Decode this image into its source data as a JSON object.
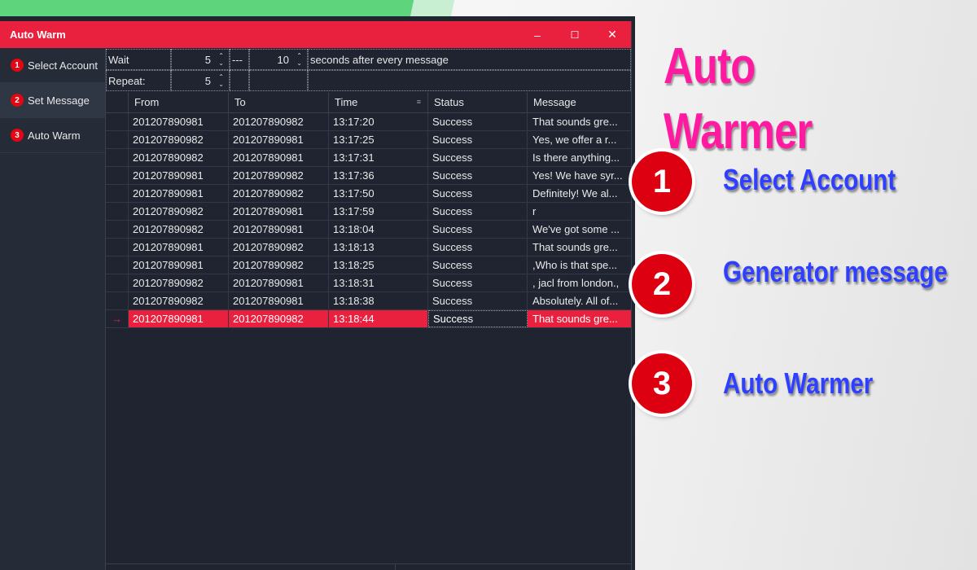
{
  "window": {
    "title": "Auto Warm",
    "controls": {
      "minimize": "–",
      "maximize": "☐",
      "close": "✕"
    }
  },
  "sidebar": {
    "items": [
      {
        "num": "1",
        "label": "Select Account"
      },
      {
        "num": "2",
        "label": "Set Message"
      },
      {
        "num": "3",
        "label": "Auto Warm"
      }
    ]
  },
  "settings": {
    "wait_label": "Wait",
    "wait_min": "5",
    "separator": "---",
    "wait_max": "10",
    "wait_suffix": "seconds after every message",
    "repeat_label": "Repeat:",
    "repeat_value": "5"
  },
  "grid": {
    "columns": [
      "From",
      "To",
      "Time",
      "Status",
      "Message"
    ],
    "selected_marker": "→",
    "rows": [
      {
        "from": "201207890981",
        "to": "201207890982",
        "time": "13:17:20",
        "status": "Success",
        "message": "That sounds gre..."
      },
      {
        "from": "201207890982",
        "to": "201207890981",
        "time": "13:17:25",
        "status": "Success",
        "message": "Yes, we offer a r..."
      },
      {
        "from": "201207890982",
        "to": "201207890981",
        "time": "13:17:31",
        "status": "Success",
        "message": "Is there anything..."
      },
      {
        "from": "201207890981",
        "to": "201207890982",
        "time": "13:17:36",
        "status": "Success",
        "message": "Yes! We have syr..."
      },
      {
        "from": "201207890981",
        "to": "201207890982",
        "time": "13:17:50",
        "status": "Success",
        "message": "Definitely! We al..."
      },
      {
        "from": "201207890982",
        "to": "201207890981",
        "time": "13:17:59",
        "status": "Success",
        "message": "r"
      },
      {
        "from": "201207890982",
        "to": "201207890981",
        "time": "13:18:04",
        "status": "Success",
        "message": "We've got some ..."
      },
      {
        "from": "201207890981",
        "to": "201207890982",
        "time": "13:18:13",
        "status": "Success",
        "message": "That sounds gre..."
      },
      {
        "from": "201207890981",
        "to": "201207890982",
        "time": "13:18:25",
        "status": "Success",
        "message": ",Who is that spe..."
      },
      {
        "from": "201207890982",
        "to": "201207890981",
        "time": "13:18:31",
        "status": "Success",
        "message": ", jacl from london.,"
      },
      {
        "from": "201207890982",
        "to": "201207890981",
        "time": "13:18:38",
        "status": "Success",
        "message": "Absolutely. All of..."
      },
      {
        "from": "201207890981",
        "to": "201207890982",
        "time": "13:18:44",
        "status": "Success",
        "message": "That sounds gre...",
        "selected": true
      }
    ]
  },
  "promo": {
    "title": "Auto Warmer",
    "steps": [
      {
        "num": "1",
        "label": "Select Account"
      },
      {
        "num": "2",
        "label": "Generator message"
      },
      {
        "num": "3",
        "label": "Auto Warmer"
      }
    ]
  },
  "colors": {
    "accent": "#e9213f",
    "promo_title": "#ff1aa0",
    "step_label": "#2f3fff",
    "step_circle": "#dd0010"
  }
}
